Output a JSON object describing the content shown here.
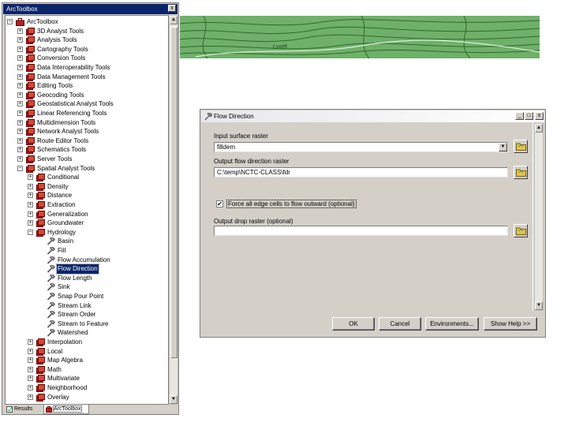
{
  "toolbox": {
    "title": "ArcToolbox",
    "close_glyph": "x",
    "tree": [
      {
        "label": "ArcToolbox",
        "depth": 0,
        "expander": "minus",
        "icon": "toolbox-icon"
      },
      {
        "label": "3D Analyst Tools",
        "depth": 1,
        "expander": "plus",
        "icon": "toolset-icon"
      },
      {
        "label": "Analysis Tools",
        "depth": 1,
        "expander": "plus",
        "icon": "toolset-icon"
      },
      {
        "label": "Cartography Tools",
        "depth": 1,
        "expander": "plus",
        "icon": "toolset-icon"
      },
      {
        "label": "Conversion Tools",
        "depth": 1,
        "expander": "plus",
        "icon": "toolset-icon"
      },
      {
        "label": "Data Interoperability Tools",
        "depth": 1,
        "expander": "plus",
        "icon": "toolset-icon"
      },
      {
        "label": "Data Management Tools",
        "depth": 1,
        "expander": "plus",
        "icon": "toolset-icon"
      },
      {
        "label": "Editing Tools",
        "depth": 1,
        "expander": "plus",
        "icon": "toolset-icon"
      },
      {
        "label": "Geocoding Tools",
        "depth": 1,
        "expander": "plus",
        "icon": "toolset-icon"
      },
      {
        "label": "Geostatistical Analyst Tools",
        "depth": 1,
        "expander": "plus",
        "icon": "toolset-icon"
      },
      {
        "label": "Linear Referencing Tools",
        "depth": 1,
        "expander": "plus",
        "icon": "toolset-icon"
      },
      {
        "label": "Multidimension Tools",
        "depth": 1,
        "expander": "plus",
        "icon": "toolset-icon"
      },
      {
        "label": "Network Analyst Tools",
        "depth": 1,
        "expander": "plus",
        "icon": "toolset-icon"
      },
      {
        "label": "Route Editor Tools",
        "depth": 1,
        "expander": "plus",
        "icon": "toolset-icon"
      },
      {
        "label": "Schematics Tools",
        "depth": 1,
        "expander": "plus",
        "icon": "toolset-icon"
      },
      {
        "label": "Server Tools",
        "depth": 1,
        "expander": "plus",
        "icon": "toolset-icon"
      },
      {
        "label": "Spatial Analyst Tools",
        "depth": 1,
        "expander": "minus",
        "icon": "toolset-icon"
      },
      {
        "label": "Conditional",
        "depth": 2,
        "expander": "plus",
        "icon": "toolset-icon"
      },
      {
        "label": "Density",
        "depth": 2,
        "expander": "plus",
        "icon": "toolset-icon"
      },
      {
        "label": "Distance",
        "depth": 2,
        "expander": "plus",
        "icon": "toolset-icon"
      },
      {
        "label": "Extraction",
        "depth": 2,
        "expander": "plus",
        "icon": "toolset-icon"
      },
      {
        "label": "Generalization",
        "depth": 2,
        "expander": "plus",
        "icon": "toolset-icon"
      },
      {
        "label": "Groundwater",
        "depth": 2,
        "expander": "plus",
        "icon": "toolset-icon"
      },
      {
        "label": "Hydrology",
        "depth": 2,
        "expander": "minus",
        "icon": "toolset-icon"
      },
      {
        "label": "Basin",
        "depth": 3,
        "expander": "none",
        "icon": "hammer-icon"
      },
      {
        "label": "Fill",
        "depth": 3,
        "expander": "none",
        "icon": "hammer-icon"
      },
      {
        "label": "Flow Accumulation",
        "depth": 3,
        "expander": "none",
        "icon": "hammer-icon"
      },
      {
        "label": "Flow Direction",
        "depth": 3,
        "expander": "none",
        "icon": "hammer-icon",
        "selected": true
      },
      {
        "label": "Flow Length",
        "depth": 3,
        "expander": "none",
        "icon": "hammer-icon"
      },
      {
        "label": "Sink",
        "depth": 3,
        "expander": "none",
        "icon": "hammer-icon"
      },
      {
        "label": "Snap Pour Point",
        "depth": 3,
        "expander": "none",
        "icon": "hammer-icon"
      },
      {
        "label": "Stream Link",
        "depth": 3,
        "expander": "none",
        "icon": "hammer-icon"
      },
      {
        "label": "Stream Order",
        "depth": 3,
        "expander": "none",
        "icon": "hammer-icon"
      },
      {
        "label": "Stream to Feature",
        "depth": 3,
        "expander": "none",
        "icon": "hammer-icon"
      },
      {
        "label": "Watershed",
        "depth": 3,
        "expander": "none",
        "icon": "hammer-icon"
      },
      {
        "label": "Interpolation",
        "depth": 2,
        "expander": "plus",
        "icon": "toolset-icon"
      },
      {
        "label": "Local",
        "depth": 2,
        "expander": "plus",
        "icon": "toolset-icon"
      },
      {
        "label": "Map Algebra",
        "depth": 2,
        "expander": "plus",
        "icon": "toolset-icon"
      },
      {
        "label": "Math",
        "depth": 2,
        "expander": "plus",
        "icon": "toolset-icon"
      },
      {
        "label": "Multivariate",
        "depth": 2,
        "expander": "plus",
        "icon": "toolset-icon"
      },
      {
        "label": "Neighborhood",
        "depth": 2,
        "expander": "plus",
        "icon": "toolset-icon"
      },
      {
        "label": "Overlay",
        "depth": 2,
        "expander": "plus",
        "icon": "toolset-icon"
      }
    ],
    "tabs": {
      "results": "Results",
      "arctoolbox": "ArcToolbox"
    }
  },
  "map": {
    "label": "Creek"
  },
  "dialog": {
    "title": "Flow Direction",
    "window_buttons": {
      "minimize": "_",
      "maximize": "□",
      "close": "x"
    },
    "input_surface_label": "Input surface raster",
    "input_surface_value": "filldem",
    "output_flow_label": "Output flow direction raster",
    "output_flow_value": "C:\\temp\\NCTC-CLASS\\fdr",
    "force_edge_label": "Force all edge cells to flow outward (optional)",
    "force_edge_checked": true,
    "output_drop_label": "Output drop raster (optional)",
    "output_drop_value": "",
    "buttons": {
      "ok": "OK",
      "cancel": "Cancel",
      "environments": "Environments...",
      "show_help": "Show Help >>"
    }
  },
  "colors": {
    "selection": "#0a246a",
    "toolset_icon": "#b22222",
    "map_green": "#6fb06a",
    "folder_yellow": "#e8c34a"
  }
}
